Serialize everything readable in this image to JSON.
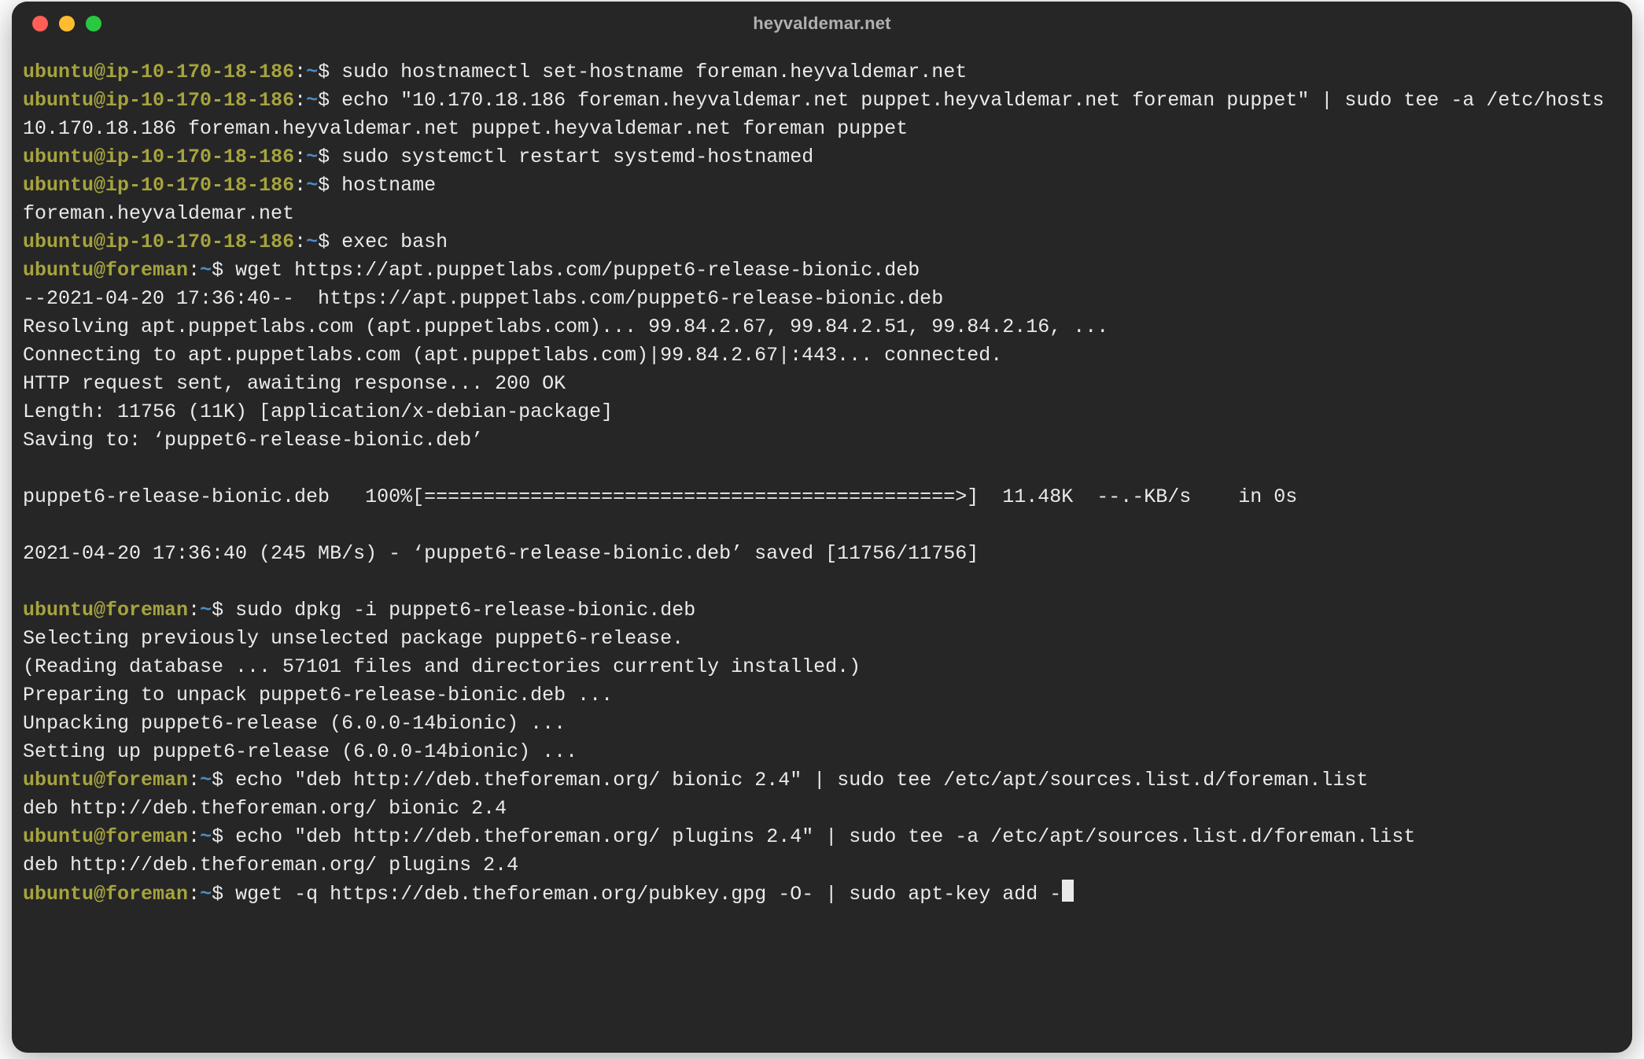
{
  "window": {
    "title": "heyvaldemar.net"
  },
  "colors": {
    "bg": "#262626",
    "fg": "#eaeaea",
    "prompt_user": "#a6a33e",
    "prompt_path": "#4e8cc2",
    "traffic_close": "#ff5f57",
    "traffic_minimize": "#febc2e",
    "traffic_zoom": "#28c840"
  },
  "session": {
    "lines": [
      {
        "type": "prompt",
        "user": "ubuntu",
        "host": "ip-10-170-18-186",
        "path": "~",
        "cmd": "sudo hostnamectl set-hostname foreman.heyvaldemar.net"
      },
      {
        "type": "prompt",
        "user": "ubuntu",
        "host": "ip-10-170-18-186",
        "path": "~",
        "cmd": "echo \"10.170.18.186 foreman.heyvaldemar.net puppet.heyvaldemar.net foreman puppet\" | sudo tee -a /etc/hosts"
      },
      {
        "type": "output",
        "text": "10.170.18.186 foreman.heyvaldemar.net puppet.heyvaldemar.net foreman puppet"
      },
      {
        "type": "prompt",
        "user": "ubuntu",
        "host": "ip-10-170-18-186",
        "path": "~",
        "cmd": "sudo systemctl restart systemd-hostnamed"
      },
      {
        "type": "prompt",
        "user": "ubuntu",
        "host": "ip-10-170-18-186",
        "path": "~",
        "cmd": "hostname"
      },
      {
        "type": "output",
        "text": "foreman.heyvaldemar.net"
      },
      {
        "type": "prompt",
        "user": "ubuntu",
        "host": "ip-10-170-18-186",
        "path": "~",
        "cmd": "exec bash"
      },
      {
        "type": "prompt",
        "user": "ubuntu",
        "host": "foreman",
        "path": "~",
        "cmd": "wget https://apt.puppetlabs.com/puppet6-release-bionic.deb"
      },
      {
        "type": "output",
        "text": "--2021-04-20 17:36:40--  https://apt.puppetlabs.com/puppet6-release-bionic.deb"
      },
      {
        "type": "output",
        "text": "Resolving apt.puppetlabs.com (apt.puppetlabs.com)... 99.84.2.67, 99.84.2.51, 99.84.2.16, ..."
      },
      {
        "type": "output",
        "text": "Connecting to apt.puppetlabs.com (apt.puppetlabs.com)|99.84.2.67|:443... connected."
      },
      {
        "type": "output",
        "text": "HTTP request sent, awaiting response... 200 OK"
      },
      {
        "type": "output",
        "text": "Length: 11756 (11K) [application/x-debian-package]"
      },
      {
        "type": "output",
        "text": "Saving to: ‘puppet6-release-bionic.deb’"
      },
      {
        "type": "blank"
      },
      {
        "type": "output",
        "text": "puppet6-release-bionic.deb   100%[=============================================>]  11.48K  --.-KB/s    in 0s"
      },
      {
        "type": "blank"
      },
      {
        "type": "output",
        "text": "2021-04-20 17:36:40 (245 MB/s) - ‘puppet6-release-bionic.deb’ saved [11756/11756]"
      },
      {
        "type": "blank"
      },
      {
        "type": "prompt",
        "user": "ubuntu",
        "host": "foreman",
        "path": "~",
        "cmd": "sudo dpkg -i puppet6-release-bionic.deb"
      },
      {
        "type": "output",
        "text": "Selecting previously unselected package puppet6-release."
      },
      {
        "type": "output",
        "text": "(Reading database ... 57101 files and directories currently installed.)"
      },
      {
        "type": "output",
        "text": "Preparing to unpack puppet6-release-bionic.deb ..."
      },
      {
        "type": "output",
        "text": "Unpacking puppet6-release (6.0.0-14bionic) ..."
      },
      {
        "type": "output",
        "text": "Setting up puppet6-release (6.0.0-14bionic) ..."
      },
      {
        "type": "prompt",
        "user": "ubuntu",
        "host": "foreman",
        "path": "~",
        "cmd": "echo \"deb http://deb.theforeman.org/ bionic 2.4\" | sudo tee /etc/apt/sources.list.d/foreman.list"
      },
      {
        "type": "output",
        "text": "deb http://deb.theforeman.org/ bionic 2.4"
      },
      {
        "type": "prompt",
        "user": "ubuntu",
        "host": "foreman",
        "path": "~",
        "cmd": "echo \"deb http://deb.theforeman.org/ plugins 2.4\" | sudo tee -a /etc/apt/sources.list.d/foreman.list"
      },
      {
        "type": "output",
        "text": "deb http://deb.theforeman.org/ plugins 2.4"
      },
      {
        "type": "prompt",
        "user": "ubuntu",
        "host": "foreman",
        "path": "~",
        "cmd": "wget -q https://deb.theforeman.org/pubkey.gpg -O- | sudo apt-key add -",
        "cursor": true
      }
    ]
  }
}
